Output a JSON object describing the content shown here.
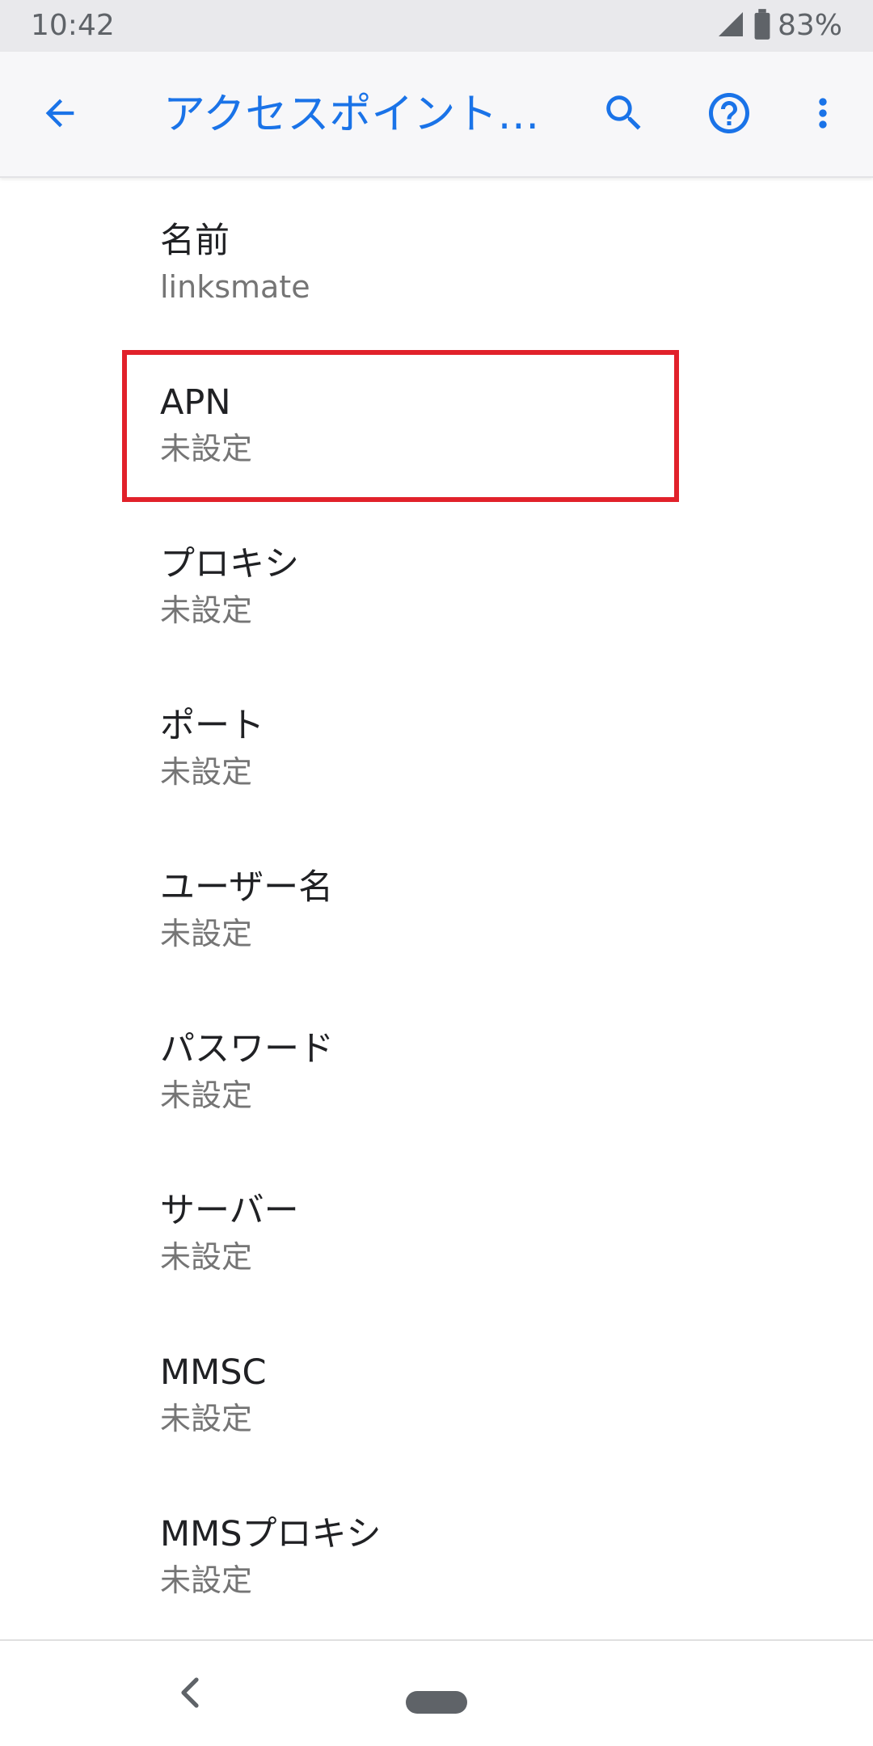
{
  "status_bar": {
    "time": "10:42",
    "battery": "83%",
    "icons": [
      "signal-icon",
      "battery-icon"
    ]
  },
  "app_bar": {
    "title": "アクセスポイント…",
    "icons": [
      "back-arrow-icon",
      "search-icon",
      "help-icon",
      "more-vert-icon"
    ],
    "accent_color": "#1a73e8"
  },
  "preferences": [
    {
      "title": "名前",
      "summary": "linksmate"
    },
    {
      "title": "APN",
      "summary": "未設定"
    },
    {
      "title": "プロキシ",
      "summary": "未設定"
    },
    {
      "title": "ポート",
      "summary": "未設定"
    },
    {
      "title": "ユーザー名",
      "summary": "未設定"
    },
    {
      "title": "パスワード",
      "summary": "未設定"
    },
    {
      "title": "サーバー",
      "summary": "未設定"
    },
    {
      "title": "MMSC",
      "summary": "未設定"
    },
    {
      "title": "MMSプロキシ",
      "summary": "未設定"
    }
  ],
  "highlight": {
    "target": "APN",
    "color": "#e1212a"
  },
  "nav_bar": {
    "icons": [
      "nav-back-icon",
      "nav-home-pill"
    ]
  }
}
